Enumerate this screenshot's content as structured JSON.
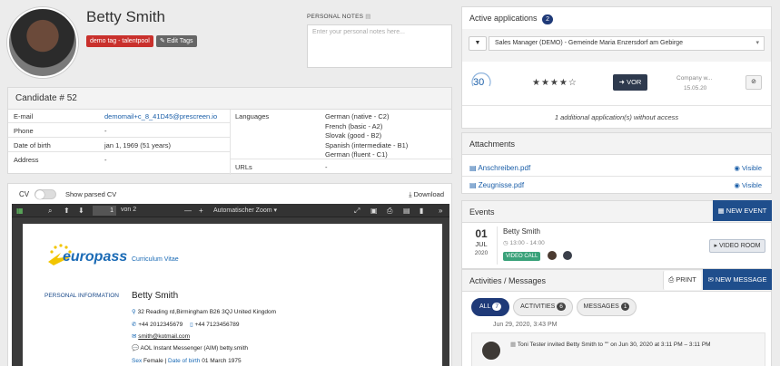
{
  "profile": {
    "name": "Betty Smith",
    "tag": "demo tag - talentpool",
    "edit_tags": "Edit Tags"
  },
  "notes": {
    "label": "PERSONAL NOTES",
    "placeholder": "Enter your personal notes here..."
  },
  "candidate": {
    "title": "Candidate # 52",
    "rows": [
      {
        "key": "E-mail",
        "value": "demomail+c_8_41D45@prescreen.io"
      },
      {
        "key": "Phone",
        "value": "-"
      },
      {
        "key": "Date of birth",
        "value": "jan 1, 1969 (51 years)"
      },
      {
        "key": "Address",
        "value": "-"
      }
    ],
    "languages_label": "Languages",
    "languages": [
      "German (native - C2)",
      "French (basic - A2)",
      "Slovak (good - B2)",
      "Spanish (intermediate - B1)",
      "German (fluent - C1)"
    ],
    "urls_label": "URLs",
    "urls_value": "-"
  },
  "cv": {
    "label": "CV",
    "parsed_label": "Show parsed CV",
    "download": "Download",
    "page_input": "1",
    "page_of": "von 2",
    "zoom": "Automatischer Zoom",
    "doc": {
      "logo": "europass",
      "doc_title": "Curriculum Vitae",
      "section": "PERSONAL INFORMATION",
      "name": "Betty Smith",
      "address": "32 Reading rd,Birmingham B26 3QJ United Kingdom",
      "phone1": "+44 2012345679",
      "phone2": "+44 7123456789",
      "email": "smith@kotmail.com",
      "im": "AOL Instant Messenger (AIM) betty.smith",
      "sex_label": "Sex",
      "sex": "Female",
      "dob_label": "Date of birth",
      "dob": "01 March 1975"
    }
  },
  "applications": {
    "title": "Active applications",
    "count": "2",
    "selected": "Sales Manager (DEMO) - Gemeinde Maria Enzersdorf am Gebirge",
    "score": "30",
    "stars": "★★★★☆",
    "vor": "VOR",
    "company": "Company w...",
    "date": "15.05.20",
    "additional": "1 additional application(s) without access"
  },
  "attachments": {
    "title": "Attachments",
    "files": [
      {
        "name": "Anschreiben.pdf",
        "status": "Visible"
      },
      {
        "name": "Zeugnisse.pdf",
        "status": "Visible"
      }
    ]
  },
  "events": {
    "title": "Events",
    "new_event": "NEW EVENT",
    "day": "01",
    "month": "JUL",
    "year": "2020",
    "name": "Betty Smith",
    "time": "13:00 - 14:00",
    "type": "VIDEO CALL",
    "video_room": "VIDEO ROOM"
  },
  "activities": {
    "title": "Activities / Messages",
    "print": "PRINT",
    "new_message": "NEW MESSAGE",
    "filters": [
      {
        "label": "ALL",
        "count": "7"
      },
      {
        "label": "ACTIVITIES",
        "count": "6"
      },
      {
        "label": "MESSAGES",
        "count": "1"
      }
    ],
    "date": "Jun 29, 2020, 3:43 PM",
    "entry": "Toni Tester invited Betty Smith to \"\" on Jun 30, 2020 at 3:11 PM – 3:11 PM"
  },
  "colors": {
    "navy": "#1f3a78",
    "tag_red": "#c9302c",
    "video_call": "#3aa27a"
  }
}
